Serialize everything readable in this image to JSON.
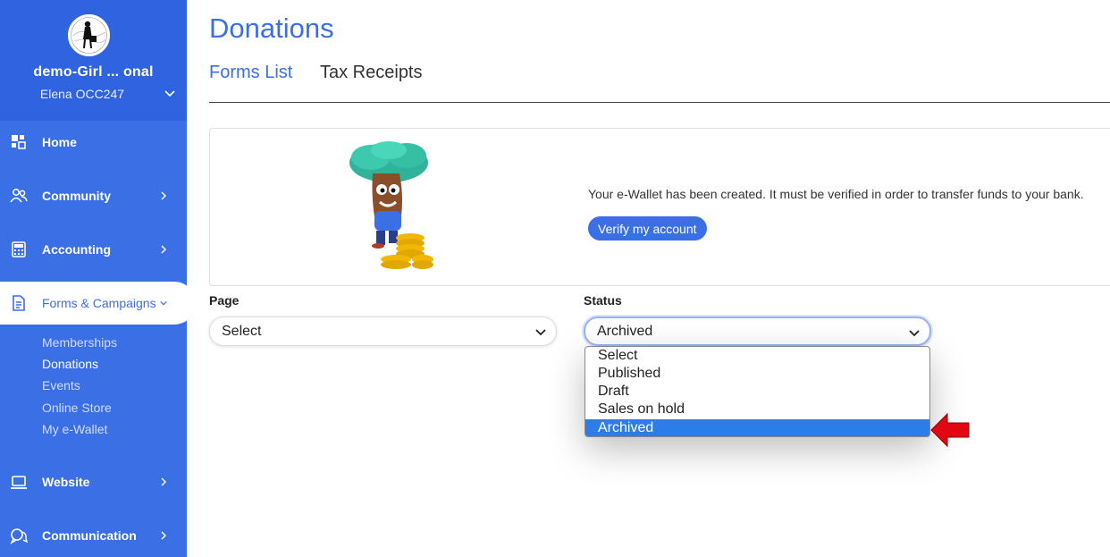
{
  "sidebar": {
    "org_name": "demo-Girl ... onal",
    "user_name": "Elena OCC247",
    "nav": [
      {
        "label": "Home",
        "icon": "dashboard-icon"
      },
      {
        "label": "Community",
        "icon": "community-icon"
      },
      {
        "label": "Accounting",
        "icon": "calculator-icon"
      },
      {
        "label": "Forms & Campaigns",
        "icon": "document-icon"
      },
      {
        "label": "Website",
        "icon": "laptop-icon"
      },
      {
        "label": "Communication",
        "icon": "chat-icon"
      }
    ],
    "sub_items": [
      "Memberships",
      "Donations",
      "Events",
      "Online Store",
      "My e-Wallet"
    ]
  },
  "main": {
    "title": "Donations",
    "tabs": [
      {
        "label": "Forms List"
      },
      {
        "label": "Tax Receipts"
      }
    ],
    "banner": {
      "message": "Your e-Wallet has been created. It must be verified in order to transfer funds to your bank.",
      "button_label": "Verify my account"
    },
    "filters": {
      "page_label": "Page",
      "page_value": "Select",
      "status_label": "Status",
      "status_value": "Archived",
      "status_options": [
        "Select",
        "Published",
        "Draft",
        "Sales on hold",
        "Archived"
      ]
    }
  },
  "colors": {
    "sidebar": "#3b6fe6",
    "accent": "#3b6fe6",
    "selected_option": "#2b7de9",
    "annotation_arrow": "#e30613"
  }
}
